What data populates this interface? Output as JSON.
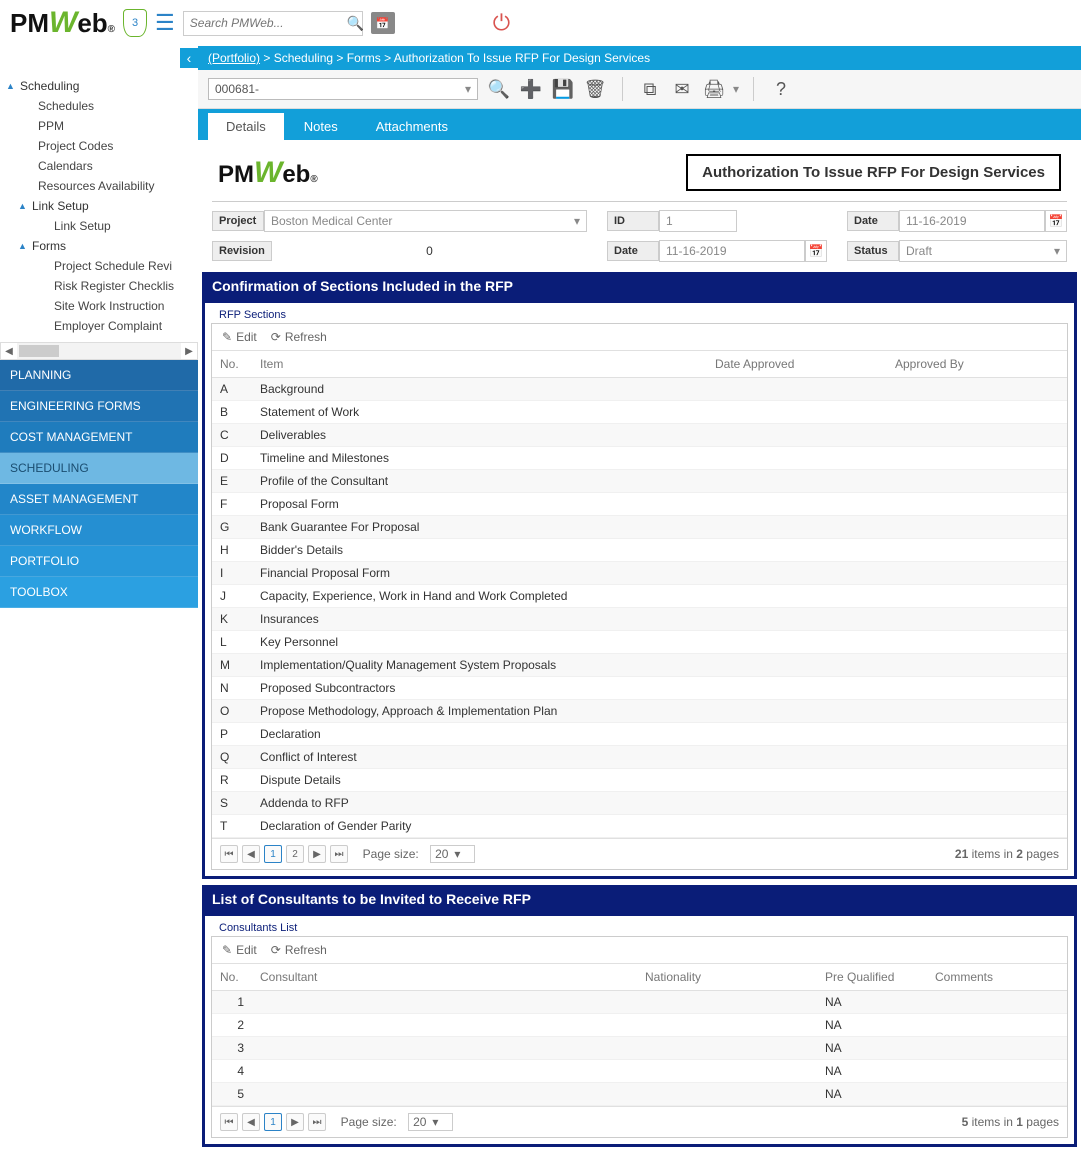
{
  "topbar": {
    "shield_count": "3",
    "search_placeholder": "Search PMWeb..."
  },
  "breadcrumb": {
    "portfolio": "(Portfolio)",
    "path": " > Scheduling > Forms > Authorization To Issue RFP For Design Services"
  },
  "record": {
    "selector_value": "000681-"
  },
  "tabs": {
    "details": "Details",
    "notes": "Notes",
    "attachments": "Attachments"
  },
  "doc_title": "Authorization To Issue RFP For Design Services",
  "fields": {
    "project_label": "Project",
    "project_value": "Boston Medical Center",
    "id_label": "ID",
    "id_value": "1",
    "date_label": "Date",
    "date_value": "11-16-2019",
    "revision_label": "Revision",
    "revision_value": "0",
    "date2_label": "Date",
    "date2_value": "11-16-2019",
    "status_label": "Status",
    "status_value": "Draft"
  },
  "sidebar": {
    "tree": {
      "scheduling": "Scheduling",
      "schedules": "Schedules",
      "ppm": "PPM",
      "project_codes": "Project Codes",
      "calendars": "Calendars",
      "resources": "Resources Availability",
      "link_setup": "Link Setup",
      "link_setup_child": "Link Setup",
      "forms": "Forms",
      "psr": "Project Schedule Revi",
      "rrc": "Risk Register Checklis",
      "swi": "Site Work Instruction",
      "ec": "Employer Complaint"
    },
    "modules": {
      "planning": "PLANNING",
      "eng": "ENGINEERING FORMS",
      "cost": "COST MANAGEMENT",
      "sched": "SCHEDULING",
      "asset": "ASSET MANAGEMENT",
      "wf": "WORKFLOW",
      "port": "PORTFOLIO",
      "tool": "TOOLBOX"
    }
  },
  "section1": {
    "title": "Confirmation of Sections Included in the RFP",
    "fieldset": "RFP Sections",
    "edit": "Edit",
    "refresh": "Refresh",
    "col_no": "No.",
    "col_item": "Item",
    "col_date": "Date Approved",
    "col_by": "Approved By",
    "rows": [
      {
        "no": "A",
        "item": "Background"
      },
      {
        "no": "B",
        "item": "Statement of Work"
      },
      {
        "no": "C",
        "item": "Deliverables"
      },
      {
        "no": "D",
        "item": "Timeline and Milestones"
      },
      {
        "no": "E",
        "item": "Profile of the Consultant"
      },
      {
        "no": "F",
        "item": "Proposal Form"
      },
      {
        "no": "G",
        "item": "Bank Guarantee For Proposal"
      },
      {
        "no": "H",
        "item": "Bidder's Details"
      },
      {
        "no": "I",
        "item": "Financial Proposal Form"
      },
      {
        "no": "J",
        "item": "Capacity, Experience, Work in Hand and Work Completed"
      },
      {
        "no": "K",
        "item": "Insurances"
      },
      {
        "no": "L",
        "item": "Key Personnel"
      },
      {
        "no": "M",
        "item": "Implementation/Quality Management System Proposals"
      },
      {
        "no": "N",
        "item": "Proposed Subcontractors"
      },
      {
        "no": "O",
        "item": "Propose Methodology, Approach & Implementation Plan"
      },
      {
        "no": "P",
        "item": "Declaration"
      },
      {
        "no": "Q",
        "item": "Conflict of Interest"
      },
      {
        "no": "R",
        "item": "Dispute Details"
      },
      {
        "no": "S",
        "item": "Addenda to RFP"
      },
      {
        "no": "T",
        "item": "Declaration of Gender Parity"
      }
    ],
    "pager": {
      "page1": "1",
      "page2": "2",
      "size_label": "Page size:",
      "size_value": "20",
      "total_items": "21",
      "items_word": " items in ",
      "total_pages": "2",
      "pages_word": " pages"
    }
  },
  "section2": {
    "title": "List of Consultants to be Invited to Receive RFP",
    "fieldset": "Consultants List",
    "edit": "Edit",
    "refresh": "Refresh",
    "col_no": "No.",
    "col_consultant": "Consultant",
    "col_nat": "Nationality",
    "col_pq": "Pre Qualified",
    "col_comments": "Comments",
    "rows": [
      {
        "no": "1",
        "pq": "NA"
      },
      {
        "no": "2",
        "pq": "NA"
      },
      {
        "no": "3",
        "pq": "NA"
      },
      {
        "no": "4",
        "pq": "NA"
      },
      {
        "no": "5",
        "pq": "NA"
      }
    ],
    "pager": {
      "page1": "1",
      "size_label": "Page size:",
      "size_value": "20",
      "total_items": "5",
      "items_word": " items in ",
      "total_pages": "1",
      "pages_word": " pages"
    }
  }
}
